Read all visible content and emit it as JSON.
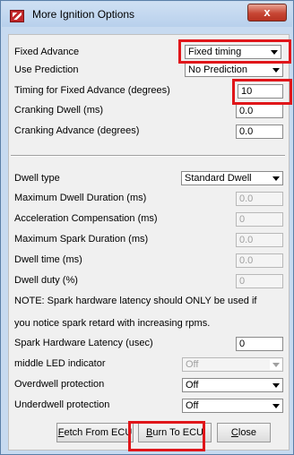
{
  "window": {
    "title": "More Ignition Options",
    "close_glyph": "x"
  },
  "fields": {
    "fixed_advance": {
      "label": "Fixed Advance",
      "value": "Fixed timing"
    },
    "use_prediction": {
      "label": "Use Prediction",
      "value": "No Prediction"
    },
    "timing_fixed": {
      "label": "Timing for Fixed Advance (degrees)",
      "value": "10"
    },
    "cranking_dwell": {
      "label": "Cranking Dwell (ms)",
      "value": "0.0"
    },
    "cranking_advance": {
      "label": "Cranking Advance (degrees)",
      "value": "0.0"
    },
    "dwell_type": {
      "label": "Dwell type",
      "value": "Standard Dwell"
    },
    "max_dwell": {
      "label": "Maximum Dwell Duration (ms)",
      "value": "0.0"
    },
    "accel_comp": {
      "label": "Acceleration Compensation (ms)",
      "value": "0"
    },
    "max_spark": {
      "label": "Maximum Spark Duration (ms)",
      "value": "0.0"
    },
    "dwell_time": {
      "label": "Dwell time (ms)",
      "value": "0.0"
    },
    "dwell_duty": {
      "label": "Dwell duty (%)",
      "value": "0"
    },
    "note1": "NOTE: Spark hardware latency should ONLY be used if",
    "note2": "you notice spark retard with increasing rpms.",
    "spark_latency": {
      "label": "Spark Hardware Latency (usec)",
      "value": "0"
    },
    "middle_led": {
      "label": "middle LED indicator",
      "value": "Off"
    },
    "overdwell": {
      "label": "Overdwell protection",
      "value": "Off"
    },
    "underdwell": {
      "label": "Underdwell protection",
      "value": "Off"
    }
  },
  "buttons": {
    "fetch": {
      "mnemonic": "F",
      "rest": "etch From ECU"
    },
    "burn": {
      "mnemonic": "B",
      "rest": "urn To ECU"
    },
    "close": {
      "mnemonic": "C",
      "rest": "lose"
    }
  },
  "colors": {
    "highlight": "#e0161a",
    "title_bar": "#c7daf0",
    "close_button": "#c74634"
  }
}
